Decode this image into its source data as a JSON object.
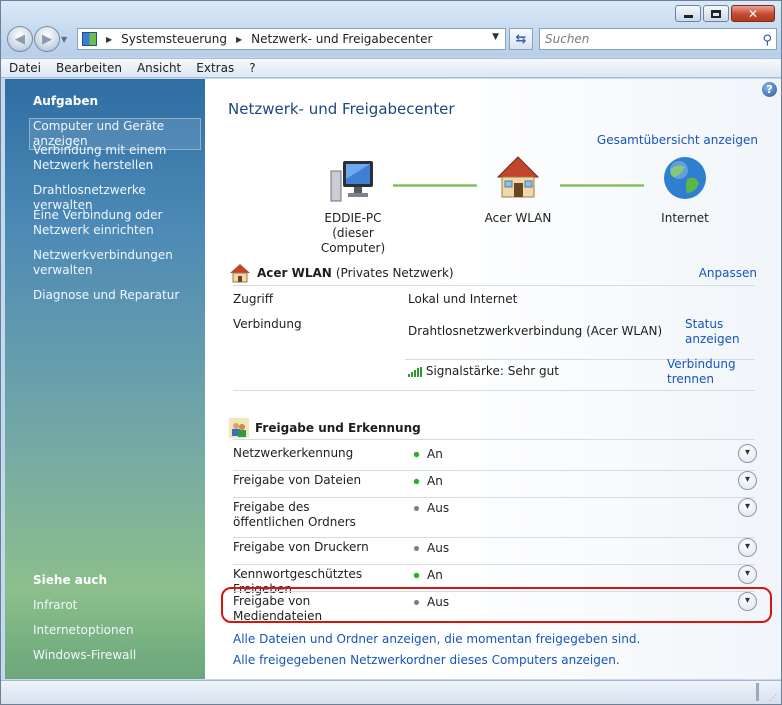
{
  "window": {
    "controls": [
      "minimize-icon",
      "maximize-icon",
      "close-icon"
    ]
  },
  "address": {
    "crumbs": [
      "Systemsteuerung",
      "Netzwerk- und Freigabecenter"
    ],
    "search_placeholder": "Suchen"
  },
  "menu": [
    "Datei",
    "Bearbeiten",
    "Ansicht",
    "Extras",
    "?"
  ],
  "sidebar": {
    "tasks_heading": "Aufgaben",
    "tasks": [
      "Computer und Geräte anzeigen",
      "Verbindung mit einem Netzwerk herstellen",
      "Drahtlosnetzwerke verwalten",
      "Eine Verbindung oder Netzwerk einrichten",
      "Netzwerkverbindungen verwalten",
      "Diagnose und Reparatur"
    ],
    "see_also_heading": "Siehe auch",
    "see_also": [
      "Infrarot",
      "Internetoptionen",
      "Windows-Firewall"
    ]
  },
  "main": {
    "title": "Netzwerk- und Freigabecenter",
    "overview_link": "Gesamtübersicht anzeigen",
    "map": {
      "pc": "EDDIE-PC",
      "pc_sub": "(dieser Computer)",
      "network": "Acer WLAN",
      "internet": "Internet"
    },
    "network": {
      "name": "Acer WLAN",
      "type": "(Privates Netzwerk)",
      "customize": "Anpassen",
      "access_label": "Zugriff",
      "access_value": "Lokal und Internet",
      "connection_label": "Verbindung",
      "connection_value": "Drahtlosnetzwerkverbindung (Acer WLAN)",
      "status_link": "Status anzeigen",
      "signal": "Signalstärke: Sehr gut",
      "disconnect_link": "Verbindung trennen"
    },
    "sharing": {
      "heading": "Freigabe und Erkennung",
      "items": [
        {
          "label": "Netzwerkerkennung",
          "state": "An",
          "on": true
        },
        {
          "label": "Freigabe von Dateien",
          "state": "An",
          "on": true
        },
        {
          "label": "Freigabe des öffentlichen Ordners",
          "state": "Aus",
          "on": false
        },
        {
          "label": "Freigabe von Druckern",
          "state": "Aus",
          "on": false
        },
        {
          "label": "Kennwortgeschütztes Freigeben",
          "state": "An",
          "on": true
        },
        {
          "label": "Freigabe von Mediendateien",
          "state": "Aus",
          "on": false
        }
      ]
    },
    "links": [
      "Alle Dateien und Ordner anzeigen, die momentan freigegeben sind.",
      "Alle freigegebenen Netzwerkordner dieses Computers anzeigen."
    ]
  },
  "colors": {
    "link": "#1555b8",
    "title": "#1c4784",
    "highlight": "#d9140e",
    "on": "#24b024",
    "off": "#7d7d7d"
  }
}
